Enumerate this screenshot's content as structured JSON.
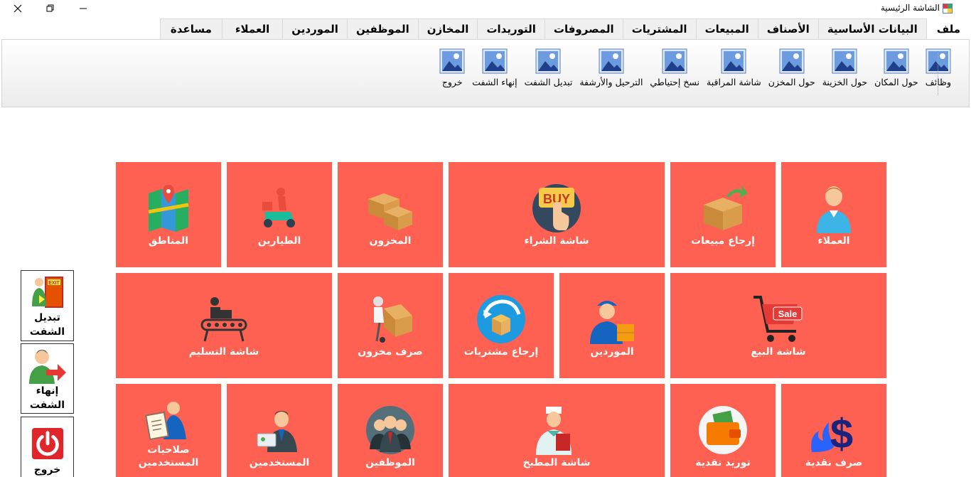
{
  "window": {
    "title": "الشاشة الرئيسية"
  },
  "menu_tabs": [
    "ملف",
    "البيانات الأساسية",
    "الأصناف",
    "المبيعات",
    "المشتريات",
    "المصروفات",
    "التوريدات",
    "المخازن",
    "الموظفين",
    "الموردين",
    "العملاء",
    "مساعدة"
  ],
  "ribbon_items": [
    {
      "label": "وظائف",
      "icon": "image-icon"
    },
    {
      "label": "حول المكان",
      "icon": "image-icon"
    },
    {
      "label": "حول الخزينة",
      "icon": "image-icon"
    },
    {
      "label": "حول المخزن",
      "icon": "image-icon"
    },
    {
      "label": "شاشة المراقبة",
      "icon": "image-icon"
    },
    {
      "label": "نسخ إحتياطي",
      "icon": "image-icon"
    },
    {
      "label": "الترحيل والأرشفة",
      "icon": "image-icon"
    },
    {
      "label": "تبديل الشفت",
      "icon": "image-icon"
    },
    {
      "label": "إنهاء الشفت",
      "icon": "image-icon"
    },
    {
      "label": "خروج",
      "icon": "image-icon"
    }
  ],
  "tiles": {
    "customers": "العملاء",
    "sales_return": "إرجاع مبيعات",
    "purchase_screen": "شاشة الشراء",
    "stock": "المخزون",
    "pilots": "الطيارين",
    "regions": "المناطق",
    "sales_screen": "شاشة البيع",
    "suppliers": "الموردين",
    "purchase_return": "إرجاع مشتريات",
    "stock_issue": "صرف مخزون",
    "delivery_screen": "شاشة التسليم",
    "cash_out": "صرف نقدية",
    "cash_in": "توريد نقدية",
    "kitchen_screen": "شاشة المطبخ",
    "employees": "الموظفين",
    "users": "المستخدمين",
    "user_permissions": "صلاحيات المستخدمين"
  },
  "side_buttons": {
    "switch_shift": "تبديل الشفت",
    "end_shift": "إنهاء الشفت",
    "exit": "خروج"
  },
  "colors": {
    "tile": "#fe6152",
    "tile_text": "#ffffff",
    "accent": "#e0252b"
  }
}
